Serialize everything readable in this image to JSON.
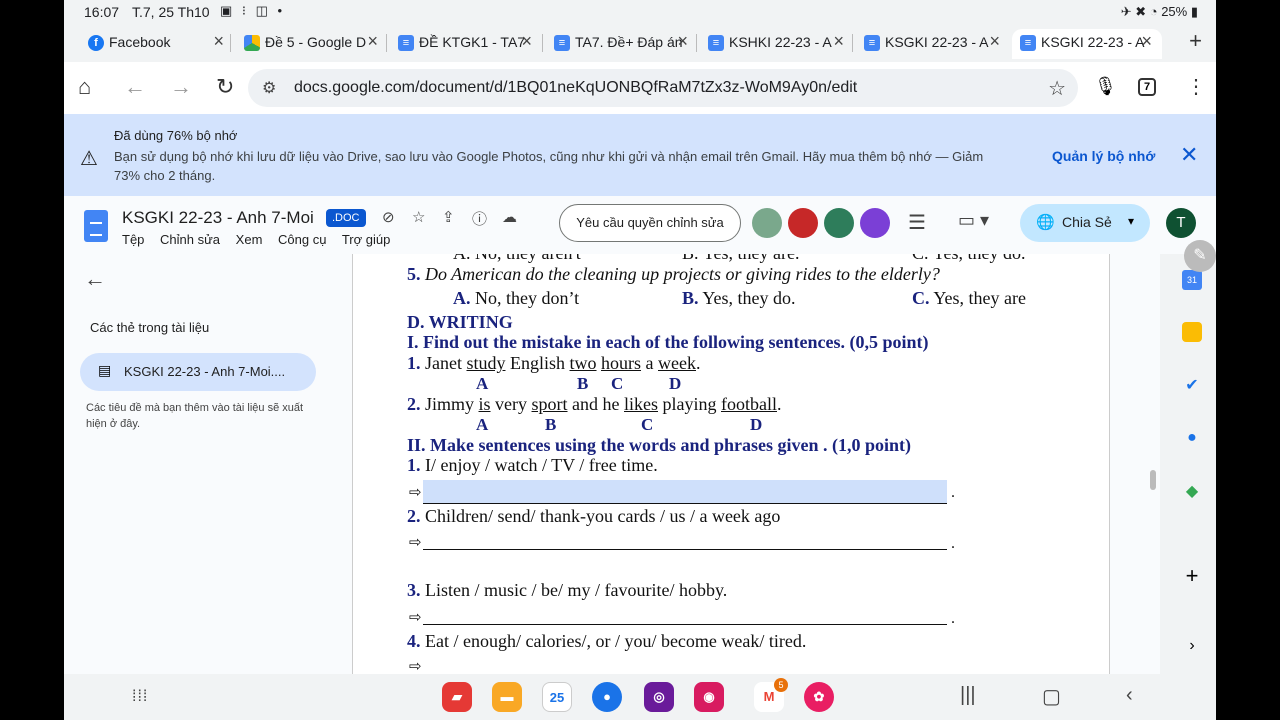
{
  "status": {
    "time": "16:07",
    "date": "T.7, 25 Th10",
    "battery": "25%"
  },
  "tabs": [
    {
      "label": "Facebook",
      "icon": "facebook-icon",
      "kind": "fb"
    },
    {
      "label": "Đề 5 - Google D",
      "icon": "drive-icon",
      "kind": "drive"
    },
    {
      "label": "ĐỀ KTGK1 - TA7",
      "icon": "docs-icon",
      "kind": "doc"
    },
    {
      "label": "TA7. Đề+ Đáp án",
      "icon": "docs-icon",
      "kind": "doc"
    },
    {
      "label": "KSHKI 22-23 - A",
      "icon": "docs-icon",
      "kind": "doc"
    },
    {
      "label": "KSGKI 22-23 - A",
      "icon": "docs-icon",
      "kind": "doc"
    },
    {
      "label": "KSGKI 22-23 - A",
      "icon": "docs-icon",
      "kind": "doc",
      "active": true
    }
  ],
  "address": {
    "url": "docs.google.com/document/d/1BQ01neKqUONBQfRaM7tZx3z-WoM9Ay0n/edit",
    "tab_count": "7"
  },
  "banner": {
    "title": "Đã dùng 76% bộ nhớ",
    "message": "Bạn sử dụng bộ nhớ khi lưu dữ liệu vào Drive, sao lưu vào Google Photos, cũng như khi gửi và nhận email trên Gmail. Hãy mua thêm bộ nhớ — Giảm 73% cho 2 tháng.",
    "action": "Quản lý bộ nhớ"
  },
  "docs": {
    "title": "KSGKI 22-23 - Anh 7-Moi",
    "badge": ".DOC",
    "menus": [
      "Tệp",
      "Chỉnh sửa",
      "Xem",
      "Công cụ",
      "Trợ giúp"
    ],
    "request_button": "Yêu cầu quyền chỉnh sửa",
    "share_label": "Chia Sẻ",
    "avatar_letter": "T"
  },
  "outline": {
    "title": "Các thẻ trong tài liệu",
    "item": "KSGKI 22-23 - Anh 7-Moi....",
    "hint": "Các tiêu đề mà bạn thêm vào tài liệu sẽ xuất hiện ở đây."
  },
  "document": {
    "cut_line": {
      "a": "A. No, they aren't",
      "b": "B. Yes, they are.",
      "c": "C. Yes, they do."
    },
    "q5": {
      "num": "5.",
      "text": "Do American do the cleaning up projects or giving rides to the elderly?"
    },
    "q5_options": {
      "a_letter": "A.",
      "a": "No, they don’t",
      "b_letter": "B.",
      "b": "Yes, they do.",
      "c_letter": "C.",
      "c": "Yes, they are"
    },
    "section_d": "D. WRITING",
    "section_i": "I. Find out the mistake in each of the following sentences. (0,5 point)",
    "s1": {
      "num": "1.",
      "w1": "Janet",
      "w2": "study",
      "w3": "English",
      "w4": "two",
      "w5": "hours",
      "w6": "a",
      "w7": "week",
      "end": "."
    },
    "s1_letters": [
      "A",
      "B",
      "C",
      "D"
    ],
    "s2": {
      "num": "2.",
      "w1": "Jimmy",
      "w2": "is",
      "w3": "very",
      "w4": "sport",
      "w5": "and he",
      "w6": "likes",
      "w7": "playing",
      "w8": "football",
      "end": "."
    },
    "s2_letters": [
      "A",
      "B",
      "C",
      "D"
    ],
    "section_ii": "II. Make sentences using the words and phrases given . (1,0 point)",
    "m1": {
      "num": "1.",
      "text": "I/ enjoy / watch / TV / free time."
    },
    "m2": {
      "num": "2.",
      "text": "Children/ send/ thank-you cards / us / a week ago"
    },
    "m3": {
      "num": "3.",
      "text": "Listen / music / be/ my / favourite/ hobby."
    },
    "m4": {
      "num": "4.",
      "text": "Eat / enough/ calories/, or / you/ become weak/ tired."
    },
    "arrow_glyph": "⇨",
    "blank_end": "."
  },
  "navbar": {
    "calendar_day": "25",
    "gmail_badge": "5"
  },
  "colors": {
    "accent": "#0b57d0",
    "banner_bg": "#d3e3fd",
    "doc_blue_text": "#1a237e"
  }
}
